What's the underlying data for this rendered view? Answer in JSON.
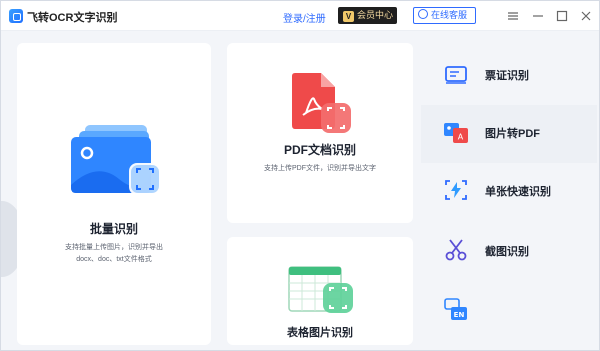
{
  "app": {
    "title": "飞转OCR文字识别"
  },
  "header": {
    "login_label": "登录/注册",
    "vip_label": "会员中心",
    "service_label": "在线客服"
  },
  "cards": {
    "batch": {
      "title": "批量识别",
      "desc_line1": "支持批量上传图片，识别并导出",
      "desc_line2": "docx、doc、txt文件格式"
    },
    "pdf": {
      "title": "PDF文档识别",
      "desc": "支持上传PDF文件，识别并导出文字"
    },
    "table": {
      "title": "表格图片识别"
    }
  },
  "sidebar": {
    "items": [
      {
        "label": "票证识别"
      },
      {
        "label": "图片转PDF"
      },
      {
        "label": "单张快速识别"
      },
      {
        "label": "截图识别"
      },
      {
        "label": ""
      }
    ]
  },
  "icons": {
    "en_badge": "EN",
    "pdf_glyph": "A",
    "vip_mark": "V"
  },
  "colors": {
    "accent": "#2f6bff",
    "pdf_red": "#ef4a4a",
    "table_green": "#3fbf7f",
    "vip_dark": "#1f1f1f"
  }
}
